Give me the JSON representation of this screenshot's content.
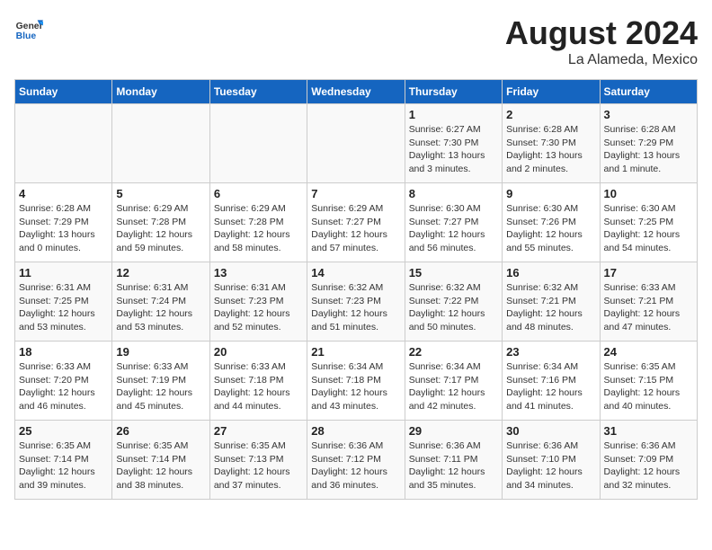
{
  "header": {
    "logo_line1": "General",
    "logo_line2": "Blue",
    "title": "August 2024",
    "subtitle": "La Alameda, Mexico"
  },
  "calendar": {
    "days_of_week": [
      "Sunday",
      "Monday",
      "Tuesday",
      "Wednesday",
      "Thursday",
      "Friday",
      "Saturday"
    ],
    "weeks": [
      [
        {
          "day": "",
          "info": ""
        },
        {
          "day": "",
          "info": ""
        },
        {
          "day": "",
          "info": ""
        },
        {
          "day": "",
          "info": ""
        },
        {
          "day": "1",
          "info": "Sunrise: 6:27 AM\nSunset: 7:30 PM\nDaylight: 13 hours\nand 3 minutes."
        },
        {
          "day": "2",
          "info": "Sunrise: 6:28 AM\nSunset: 7:30 PM\nDaylight: 13 hours\nand 2 minutes."
        },
        {
          "day": "3",
          "info": "Sunrise: 6:28 AM\nSunset: 7:29 PM\nDaylight: 13 hours\nand 1 minute."
        }
      ],
      [
        {
          "day": "4",
          "info": "Sunrise: 6:28 AM\nSunset: 7:29 PM\nDaylight: 13 hours\nand 0 minutes."
        },
        {
          "day": "5",
          "info": "Sunrise: 6:29 AM\nSunset: 7:28 PM\nDaylight: 12 hours\nand 59 minutes."
        },
        {
          "day": "6",
          "info": "Sunrise: 6:29 AM\nSunset: 7:28 PM\nDaylight: 12 hours\nand 58 minutes."
        },
        {
          "day": "7",
          "info": "Sunrise: 6:29 AM\nSunset: 7:27 PM\nDaylight: 12 hours\nand 57 minutes."
        },
        {
          "day": "8",
          "info": "Sunrise: 6:30 AM\nSunset: 7:27 PM\nDaylight: 12 hours\nand 56 minutes."
        },
        {
          "day": "9",
          "info": "Sunrise: 6:30 AM\nSunset: 7:26 PM\nDaylight: 12 hours\nand 55 minutes."
        },
        {
          "day": "10",
          "info": "Sunrise: 6:30 AM\nSunset: 7:25 PM\nDaylight: 12 hours\nand 54 minutes."
        }
      ],
      [
        {
          "day": "11",
          "info": "Sunrise: 6:31 AM\nSunset: 7:25 PM\nDaylight: 12 hours\nand 53 minutes."
        },
        {
          "day": "12",
          "info": "Sunrise: 6:31 AM\nSunset: 7:24 PM\nDaylight: 12 hours\nand 53 minutes."
        },
        {
          "day": "13",
          "info": "Sunrise: 6:31 AM\nSunset: 7:23 PM\nDaylight: 12 hours\nand 52 minutes."
        },
        {
          "day": "14",
          "info": "Sunrise: 6:32 AM\nSunset: 7:23 PM\nDaylight: 12 hours\nand 51 minutes."
        },
        {
          "day": "15",
          "info": "Sunrise: 6:32 AM\nSunset: 7:22 PM\nDaylight: 12 hours\nand 50 minutes."
        },
        {
          "day": "16",
          "info": "Sunrise: 6:32 AM\nSunset: 7:21 PM\nDaylight: 12 hours\nand 48 minutes."
        },
        {
          "day": "17",
          "info": "Sunrise: 6:33 AM\nSunset: 7:21 PM\nDaylight: 12 hours\nand 47 minutes."
        }
      ],
      [
        {
          "day": "18",
          "info": "Sunrise: 6:33 AM\nSunset: 7:20 PM\nDaylight: 12 hours\nand 46 minutes."
        },
        {
          "day": "19",
          "info": "Sunrise: 6:33 AM\nSunset: 7:19 PM\nDaylight: 12 hours\nand 45 minutes."
        },
        {
          "day": "20",
          "info": "Sunrise: 6:33 AM\nSunset: 7:18 PM\nDaylight: 12 hours\nand 44 minutes."
        },
        {
          "day": "21",
          "info": "Sunrise: 6:34 AM\nSunset: 7:18 PM\nDaylight: 12 hours\nand 43 minutes."
        },
        {
          "day": "22",
          "info": "Sunrise: 6:34 AM\nSunset: 7:17 PM\nDaylight: 12 hours\nand 42 minutes."
        },
        {
          "day": "23",
          "info": "Sunrise: 6:34 AM\nSunset: 7:16 PM\nDaylight: 12 hours\nand 41 minutes."
        },
        {
          "day": "24",
          "info": "Sunrise: 6:35 AM\nSunset: 7:15 PM\nDaylight: 12 hours\nand 40 minutes."
        }
      ],
      [
        {
          "day": "25",
          "info": "Sunrise: 6:35 AM\nSunset: 7:14 PM\nDaylight: 12 hours\nand 39 minutes."
        },
        {
          "day": "26",
          "info": "Sunrise: 6:35 AM\nSunset: 7:14 PM\nDaylight: 12 hours\nand 38 minutes."
        },
        {
          "day": "27",
          "info": "Sunrise: 6:35 AM\nSunset: 7:13 PM\nDaylight: 12 hours\nand 37 minutes."
        },
        {
          "day": "28",
          "info": "Sunrise: 6:36 AM\nSunset: 7:12 PM\nDaylight: 12 hours\nand 36 minutes."
        },
        {
          "day": "29",
          "info": "Sunrise: 6:36 AM\nSunset: 7:11 PM\nDaylight: 12 hours\nand 35 minutes."
        },
        {
          "day": "30",
          "info": "Sunrise: 6:36 AM\nSunset: 7:10 PM\nDaylight: 12 hours\nand 34 minutes."
        },
        {
          "day": "31",
          "info": "Sunrise: 6:36 AM\nSunset: 7:09 PM\nDaylight: 12 hours\nand 32 minutes."
        }
      ]
    ]
  }
}
